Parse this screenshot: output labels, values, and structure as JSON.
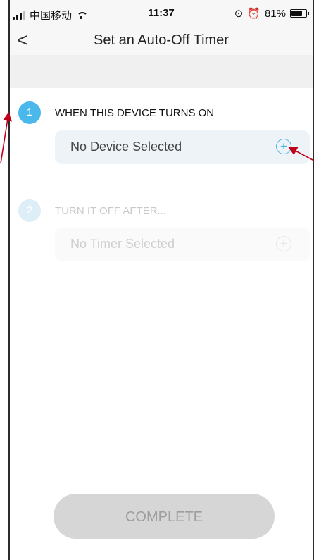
{
  "status_bar": {
    "carrier": "中国移动",
    "time": "11:37",
    "battery_percent": "81%",
    "battery_level": 0.81
  },
  "nav": {
    "back_glyph": "<",
    "title": "Set an Auto-Off Timer"
  },
  "step1": {
    "number": "1",
    "label": "WHEN THIS DEVICE TURNS ON",
    "field_text": "No Device Selected",
    "plus_glyph": "+"
  },
  "step2": {
    "number": "2",
    "label": "TURN IT OFF AFTER...",
    "field_text": "No Timer Selected",
    "plus_glyph": "+"
  },
  "actions": {
    "complete_label": "COMPLETE"
  },
  "colors": {
    "accent": "#4bb8ec",
    "annotation_arrow": "#c0001b",
    "disabled_button": "#d6d6d6"
  },
  "icons": [
    "signal-icon",
    "wifi-icon",
    "alarm-icon",
    "battery-icon",
    "back-chevron-icon",
    "add-circle-icon"
  ]
}
